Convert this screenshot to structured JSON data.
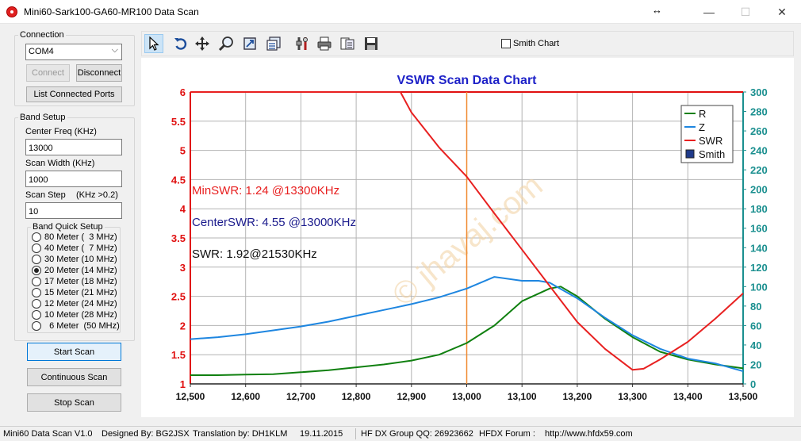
{
  "window": {
    "title": "Mini60-Sark100-GA60-MR100 Data Scan"
  },
  "connection": {
    "legend": "Connection",
    "port_value": "COM4",
    "connect_label": "Connect",
    "disconnect_label": "Disconnect",
    "list_ports_label": "List Connected Ports"
  },
  "band_setup": {
    "legend": "Band Setup",
    "center_freq_label": "Center Freq  (KHz)",
    "center_freq_value": "13000",
    "scan_width_label": "Scan Width   (KHz)",
    "scan_width_value": "1000",
    "scan_step_label": "Scan Step",
    "scan_step_hint": "(KHz >0.2)",
    "scan_step_value": "10"
  },
  "band_quick": {
    "legend": "Band Quick Setup",
    "items": [
      {
        "label": "80 Meter (  3 MHz)",
        "selected": false
      },
      {
        "label": "40 Meter (  7 MHz)",
        "selected": false
      },
      {
        "label": "30 Meter (10 MHz)",
        "selected": false
      },
      {
        "label": "20 Meter (14 MHz)",
        "selected": true
      },
      {
        "label": "17 Meter (18 MHz)",
        "selected": false
      },
      {
        "label": "15 Meter (21 MHz)",
        "selected": false
      },
      {
        "label": "12 Meter (24 MHz)",
        "selected": false
      },
      {
        "label": "10 Meter (28 MHz)",
        "selected": false
      },
      {
        "label": "  6 Meter  (50 MHz)",
        "selected": false
      }
    ]
  },
  "actions": {
    "start_scan": "Start Scan",
    "continuous_scan": "Continuous Scan",
    "stop_scan": "Stop Scan"
  },
  "toolbar": {
    "smith_chart_label": "Smith Chart",
    "smith_chart_checked": false,
    "icons": [
      "pointer-icon",
      "undo-icon",
      "pan-icon",
      "zoom-icon",
      "export-icon",
      "data-icon",
      "settings-icon",
      "print-icon",
      "report-icon",
      "save-icon"
    ]
  },
  "chart_data": {
    "type": "line",
    "title": "VSWR Scan Data Chart",
    "xlim": [
      12500,
      13500
    ],
    "x_ticks": [
      "12,500",
      "12,600",
      "12,700",
      "12,800",
      "12,900",
      "13,000",
      "13,100",
      "13,200",
      "13,300",
      "13,400",
      "13,500"
    ],
    "y_left_lim": [
      1,
      6
    ],
    "y_left_ticks": [
      "1",
      "1.5",
      "2",
      "2.5",
      "3",
      "3.5",
      "4",
      "4.5",
      "5",
      "5.5",
      "6"
    ],
    "y_right_lim": [
      0,
      300
    ],
    "y_right_ticks": [
      "0",
      "20",
      "40",
      "60",
      "80",
      "100",
      "120",
      "140",
      "160",
      "180",
      "200",
      "220",
      "240",
      "260",
      "280",
      "300"
    ],
    "marker_x": 13000,
    "grid": true,
    "legend_position": "top-right",
    "legend": [
      {
        "name": "R",
        "color": "#108010"
      },
      {
        "name": "Z",
        "color": "#1e86e0"
      },
      {
        "name": "SWR",
        "color": "#e82020"
      },
      {
        "name": "Smith",
        "color": "#1f3a8a"
      }
    ],
    "series": [
      {
        "name": "R",
        "axis": "right",
        "color": "#108010",
        "x": [
          12500,
          12550,
          12600,
          12650,
          12700,
          12750,
          12800,
          12850,
          12900,
          12950,
          13000,
          13050,
          13100,
          13150,
          13170,
          13200,
          13250,
          13300,
          13350,
          13400,
          13450,
          13500
        ],
        "y": [
          9,
          9,
          9.5,
          10,
          12,
          14,
          17,
          20,
          24,
          30,
          42,
          60,
          85,
          98,
          100,
          90,
          67,
          48,
          33,
          25,
          20,
          16
        ]
      },
      {
        "name": "Z",
        "axis": "right",
        "color": "#1e86e0",
        "x": [
          12500,
          12550,
          12600,
          12650,
          12700,
          12750,
          12800,
          12850,
          12900,
          12950,
          13000,
          13050,
          13100,
          13130,
          13150,
          13200,
          13250,
          13300,
          13350,
          13400,
          13450,
          13500
        ],
        "y": [
          46,
          48,
          51,
          55,
          59,
          64,
          70,
          76,
          82,
          89,
          98,
          110,
          106,
          106,
          104,
          88,
          68,
          50,
          36,
          26,
          21,
          13
        ]
      },
      {
        "name": "SWR",
        "axis": "left",
        "color": "#e82020",
        "x": [
          12500,
          12880,
          12900,
          12950,
          13000,
          13050,
          13100,
          13150,
          13200,
          13250,
          13300,
          13320,
          13350,
          13400,
          13450,
          13500
        ],
        "y": [
          6,
          6,
          5.65,
          5.05,
          4.55,
          3.92,
          3.3,
          2.68,
          2.06,
          1.6,
          1.24,
          1.26,
          1.42,
          1.72,
          2.12,
          2.55
        ]
      }
    ],
    "annotations": [
      {
        "text": "MinSWR: 1.24 @13300KHz",
        "color": "#e82020"
      },
      {
        "text": "CenterSWR: 4.55 @13000KHz",
        "color": "#1a1a8c"
      },
      {
        "text": "SWR: 1.92@21530KHz",
        "color": "#111111"
      }
    ],
    "watermark": "© jhavaj.com"
  },
  "status": {
    "version": "Mini60 Data Scan V1.0",
    "designed_by": "Designed By: BG2JSX",
    "translation": "Translation by: DH1KLM",
    "date": "19.11.2015",
    "group": "HF DX Group QQ: 26923662",
    "forum": "HFDX Forum :",
    "url": "http://www.hfdx59.com"
  }
}
